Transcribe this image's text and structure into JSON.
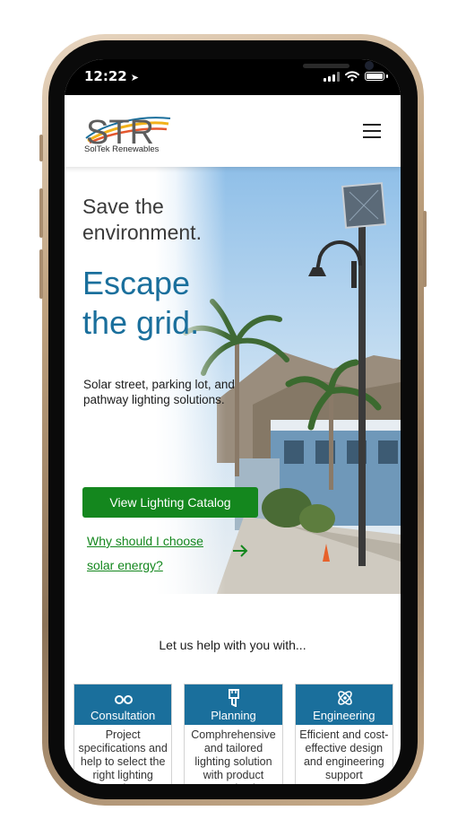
{
  "status_bar": {
    "time": "12:22"
  },
  "header": {
    "logo_text": "STR",
    "logo_tagline": "SolTek Renewables"
  },
  "hero": {
    "subheading": "Save the environment.",
    "headline": "Escape the grid.",
    "description": "Solar street, parking lot, and pathway lighting solutions.",
    "cta_label": "View Lighting Catalog",
    "link_label": "Why should I choose solar energy?"
  },
  "help": {
    "text": "Let us help with you with..."
  },
  "cards": [
    {
      "title": "Consultation",
      "icon": "glasses-icon",
      "body": "Project specifications and help to select the right lighting option"
    },
    {
      "title": "Planning",
      "icon": "paintbrush-icon",
      "body": "Comphrehensive and tailored lighting solution with product customization"
    },
    {
      "title": "Engineering",
      "icon": "atom-icon",
      "body": "Efficient and cost-effective design and engineering support"
    }
  ],
  "colors": {
    "brand_blue": "#1a6f9c",
    "brand_green": "#14871e"
  }
}
